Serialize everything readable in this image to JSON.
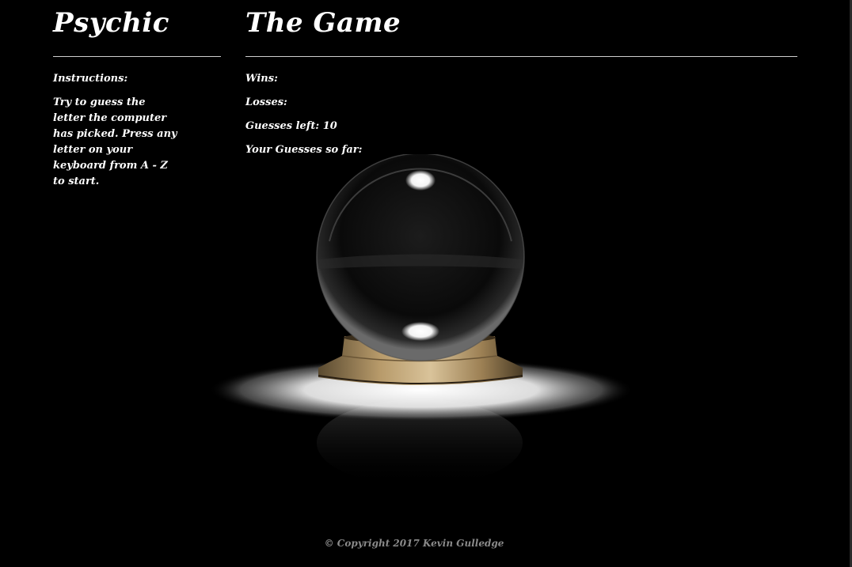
{
  "left_column": {
    "title": "Psychic",
    "instructions_heading": "Instructions:",
    "instructions_text": "Try to guess the letter the computer has picked. Press any letter on your keyboard from A - Z to start."
  },
  "game": {
    "title": "The Game",
    "wins_label": "Wins:",
    "losses_label": "Losses:",
    "guesses_left_label": "Guesses left: 10",
    "guesses_so_far_label": "Your Guesses so far:"
  },
  "footer": {
    "copyright": "© Copyright 2017 Kevin Gulledge"
  },
  "colors": {
    "background": "#000000",
    "text": "#ffffff",
    "footer_text": "#8a8a8a",
    "base_gold": "#b79a6a"
  },
  "image": {
    "subject": "crystal-ball-icon"
  }
}
